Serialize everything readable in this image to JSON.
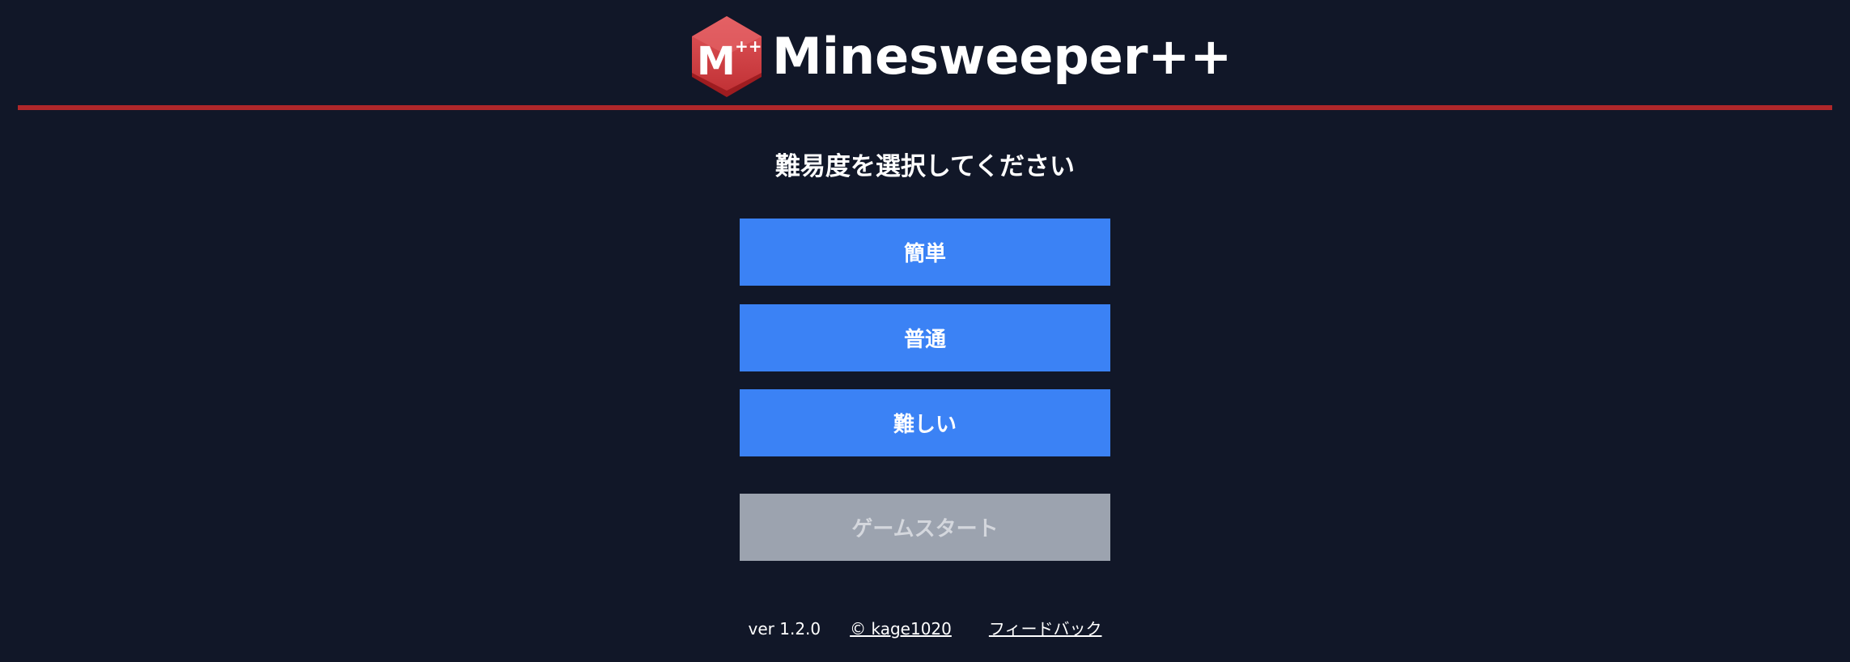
{
  "header": {
    "logo_letter": "M",
    "logo_badge": "++",
    "title": "Minesweeper++",
    "accent_color": "#b0272a"
  },
  "main": {
    "prompt": "難易度を選択してください",
    "difficulty_buttons": [
      {
        "label": "簡単"
      },
      {
        "label": "普通"
      },
      {
        "label": "難しい"
      }
    ],
    "start_button": {
      "label": "ゲームスタート",
      "enabled": false
    },
    "button_color": "#3b82f5",
    "disabled_color": "#9ca3af"
  },
  "footer": {
    "version": "ver 1.2.0",
    "copyright": "© kage1020",
    "feedback": "フィードバック"
  }
}
